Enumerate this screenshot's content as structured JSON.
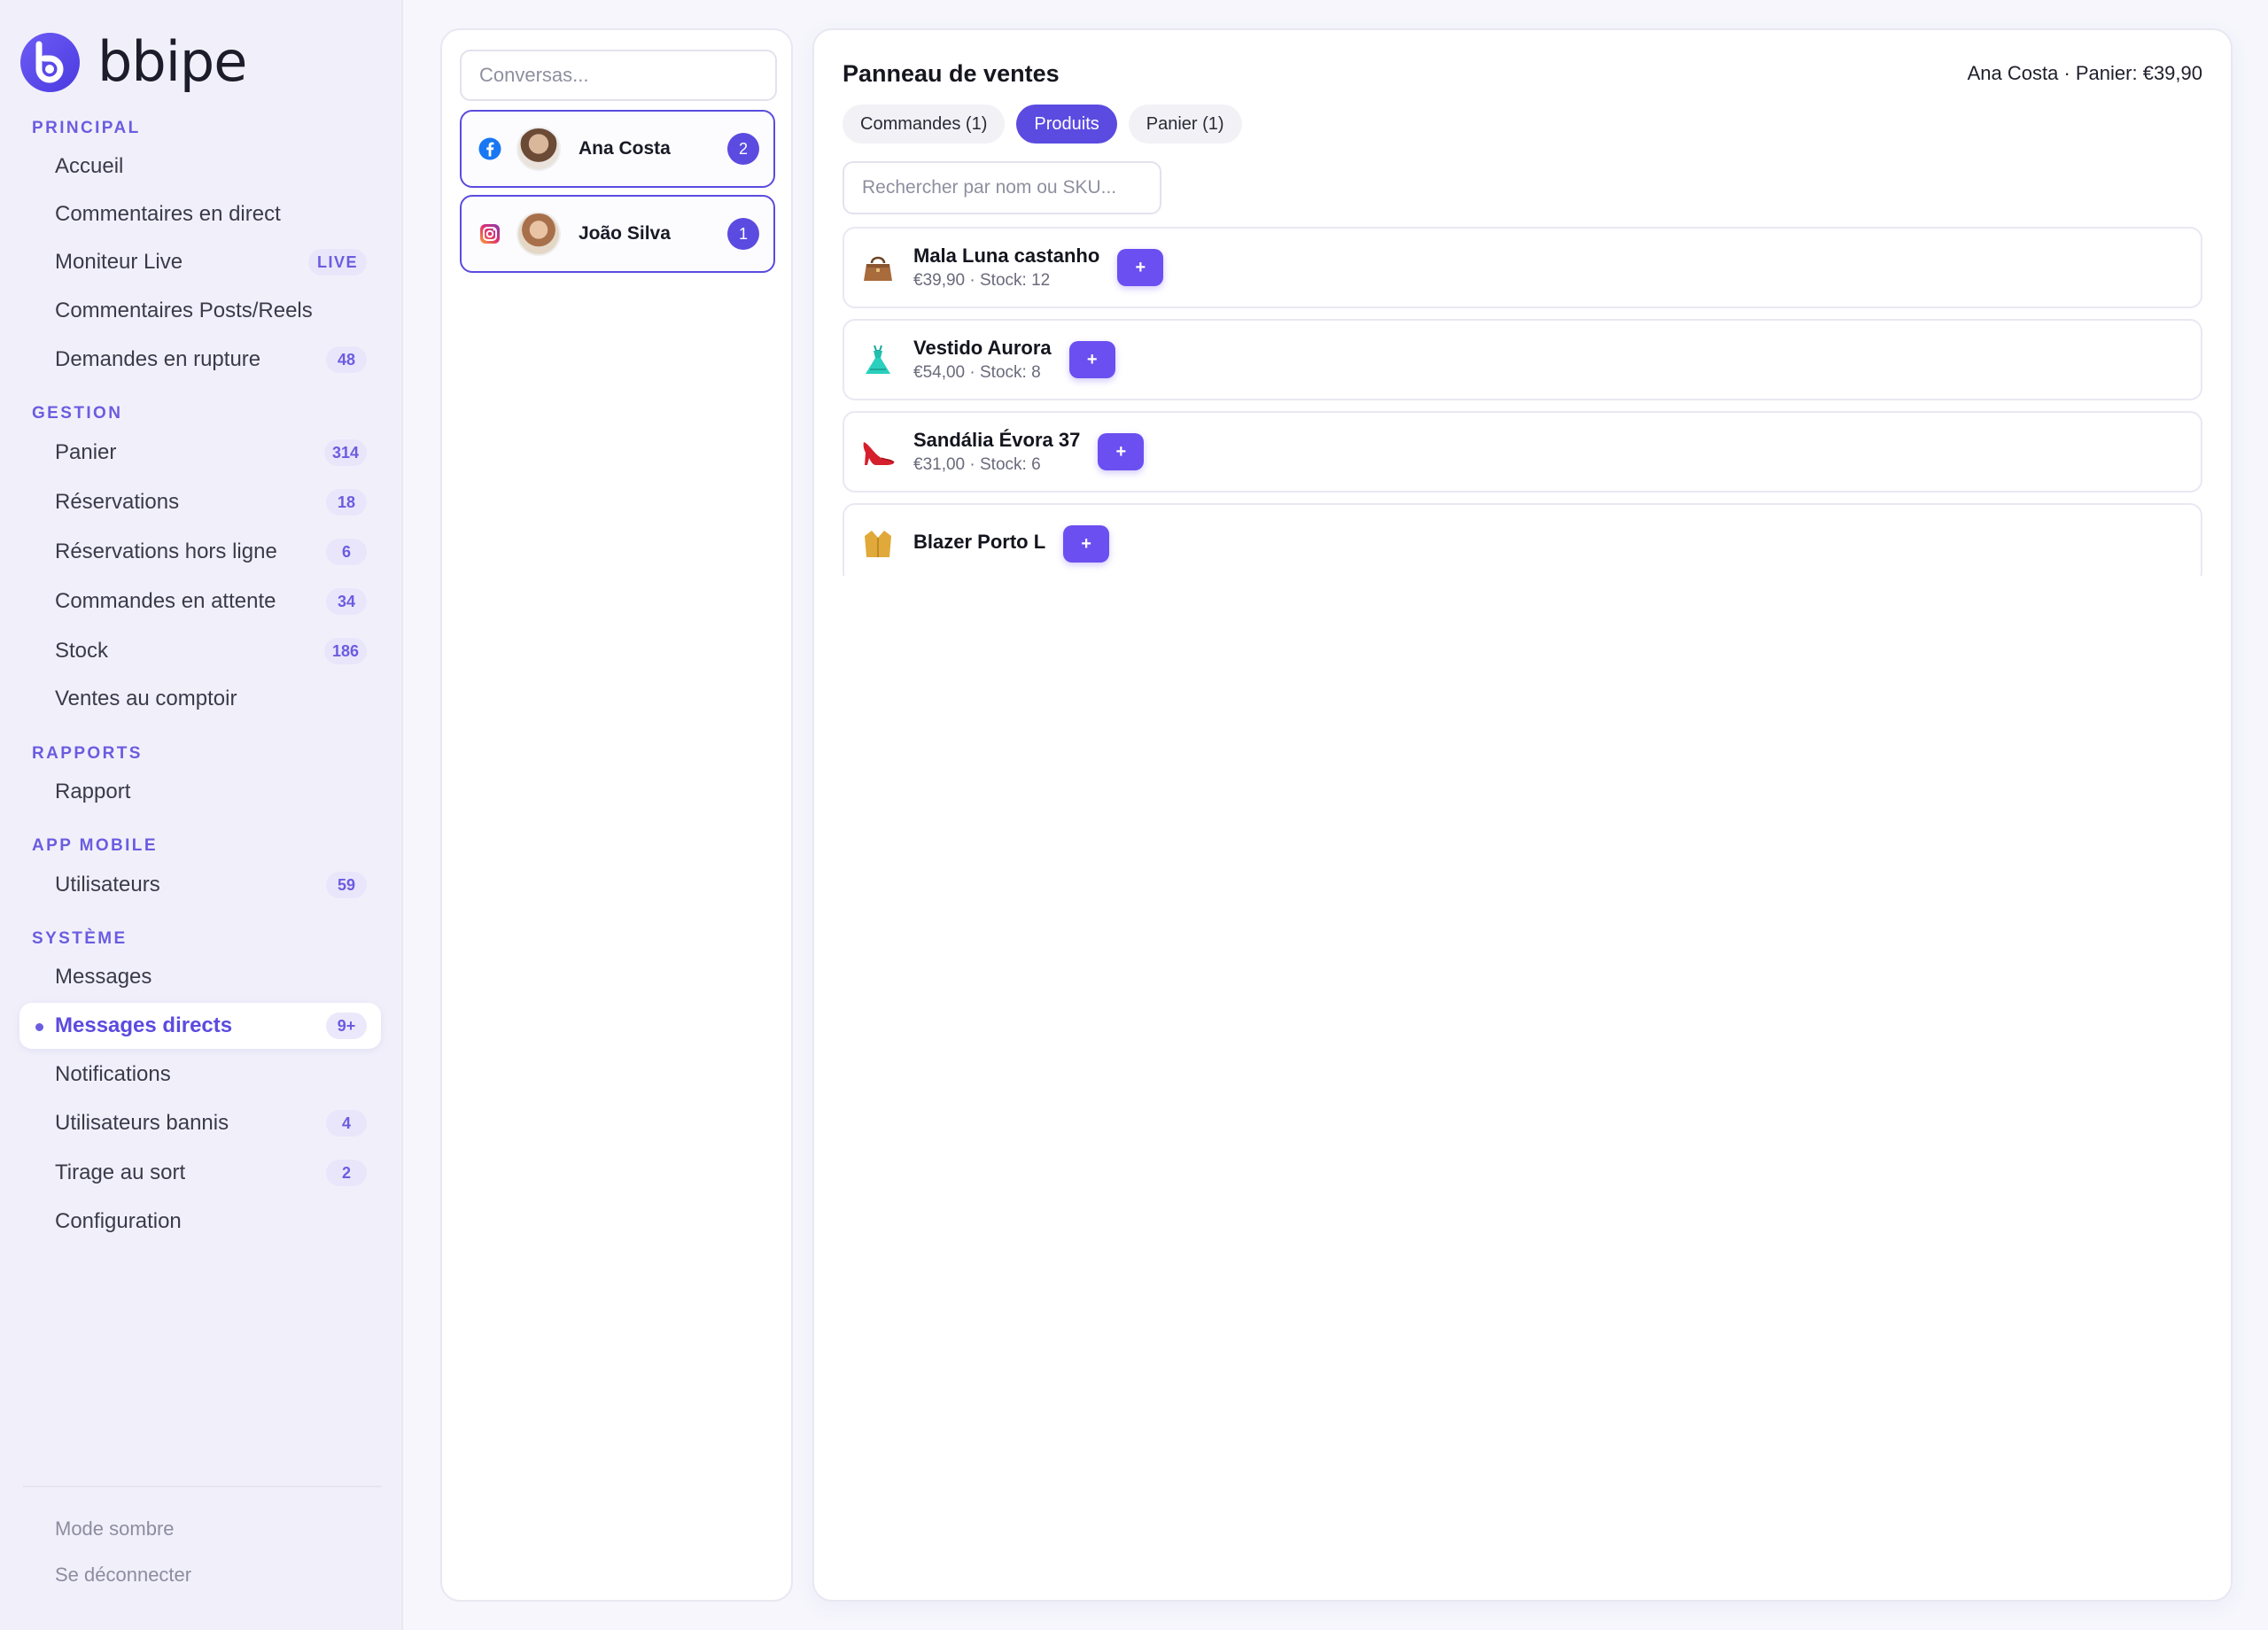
{
  "brand": {
    "name": "bbipe"
  },
  "sidebar": {
    "sections": [
      {
        "title": "PRINCIPAL",
        "items": [
          {
            "label": "Accueil"
          },
          {
            "label": "Commentaires en direct"
          },
          {
            "label": "Moniteur Live",
            "tag": "LIVE"
          },
          {
            "label": "Commentaires Posts/Reels"
          },
          {
            "label": "Demandes en rupture",
            "count": "48"
          }
        ]
      },
      {
        "title": "GESTION",
        "items": [
          {
            "label": "Panier",
            "count": "314"
          },
          {
            "label": "Réservations",
            "count": "18"
          },
          {
            "label": "Réservations hors ligne",
            "count": "6"
          },
          {
            "label": "Commandes en attente",
            "count": "34"
          },
          {
            "label": "Stock",
            "count": "186"
          },
          {
            "label": "Ventes au comptoir"
          }
        ]
      },
      {
        "title": "RAPPORTS",
        "items": [
          {
            "label": "Rapport"
          }
        ]
      },
      {
        "title": "APP MOBILE",
        "items": [
          {
            "label": "Utilisateurs",
            "count": "59"
          }
        ]
      },
      {
        "title": "SYSTÈME",
        "items": [
          {
            "label": "Messages"
          },
          {
            "label": "Messages directs",
            "count": "9+",
            "active": true
          },
          {
            "label": "Notifications"
          },
          {
            "label": "Utilisateurs bannis",
            "count": "4"
          },
          {
            "label": "Tirage au sort",
            "count": "2"
          },
          {
            "label": "Configuration"
          }
        ]
      }
    ],
    "footer": {
      "dark_mode": "Mode sombre",
      "logout": "Se déconnecter"
    }
  },
  "conversations": {
    "search_placeholder": "Conversas...",
    "items": [
      {
        "name": "Ana Costa",
        "platform": "facebook-icon",
        "unread": "2"
      },
      {
        "name": "João Silva",
        "platform": "instagram-icon",
        "unread": "1"
      }
    ]
  },
  "sales": {
    "title": "Panneau de ventes",
    "info": "Ana Costa · Panier: €39,90",
    "tabs": [
      {
        "label": "Commandes (1)"
      },
      {
        "label": "Produits",
        "active": true
      },
      {
        "label": "Panier (1)"
      }
    ],
    "search_placeholder": "Rechercher par nom ou SKU...",
    "add_label": "+",
    "products": [
      {
        "name": "Mala Luna castanho",
        "meta": "€39,90 · Stock: 12",
        "icon": "handbag-icon"
      },
      {
        "name": "Vestido Aurora",
        "meta": "€54,00 · Stock: 8",
        "icon": "dress-icon"
      },
      {
        "name": "Sandália Évora 37",
        "meta": "€31,00 · Stock: 6",
        "icon": "high-heel-icon"
      },
      {
        "name": "Blazer Porto L",
        "meta": "",
        "icon": "blazer-icon"
      }
    ]
  },
  "colors": {
    "accent": "#5b4be0",
    "sidebar_bg": "#f1f0fa",
    "page_bg": "#f6f6fc"
  }
}
